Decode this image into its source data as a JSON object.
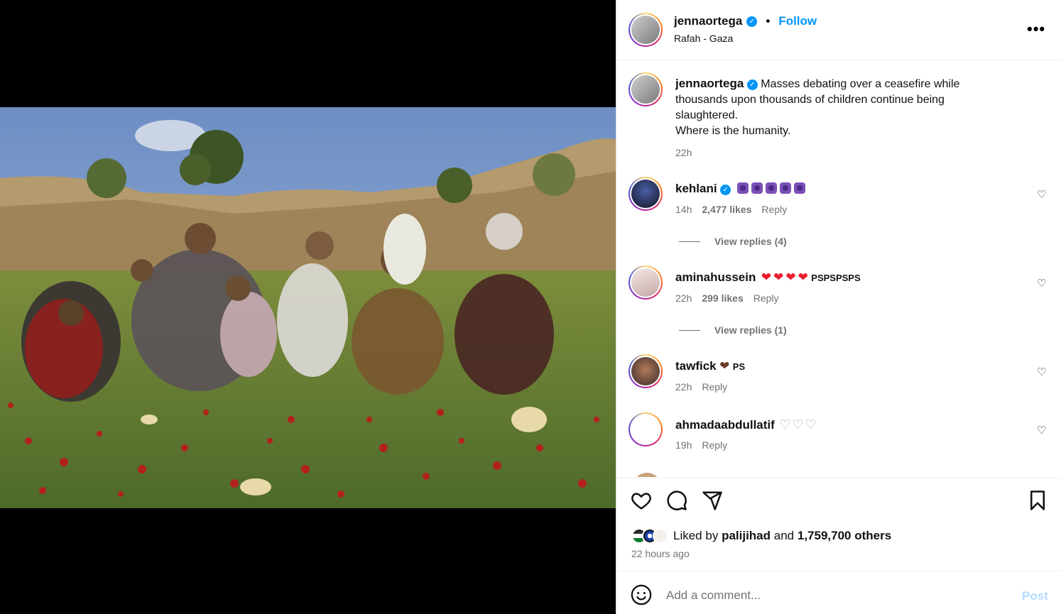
{
  "post": {
    "author": "jennaortega",
    "follow_label": "Follow",
    "dot": "•",
    "location": "Rafah - Gaza",
    "more": "•••",
    "verified_mark": "✓"
  },
  "caption": {
    "author": "jennaortega",
    "lines": [
      "Masses debating over a ceasefire while",
      "thousands upon thousands of children continue being",
      "slaughtered.",
      "Where is the humanity."
    ],
    "time": "22h"
  },
  "comments": [
    {
      "user": "kehlani",
      "verified": true,
      "text_extra": "",
      "time": "14h",
      "likes": "2,477 likes",
      "reply": "Reply",
      "view_replies": "View replies (4)"
    },
    {
      "user": "aminahussein",
      "verified": false,
      "text_extra": "PSPSPSPS",
      "time": "22h",
      "likes": "299 likes",
      "reply": "Reply",
      "view_replies": "View replies (1)"
    },
    {
      "user": "tawfick",
      "verified": false,
      "text_extra": "PS",
      "time": "22h",
      "likes": "",
      "reply": "Reply",
      "view_replies": ""
    },
    {
      "user": "ahmadaabdullatif",
      "verified": false,
      "text_extra": "",
      "time": "19h",
      "likes": "",
      "reply": "Reply",
      "view_replies": ""
    }
  ],
  "likes": {
    "prefix": "Liked by",
    "user": "palijihad",
    "and": "and",
    "count": "1,759,700 others"
  },
  "timestamp": "22 hours ago",
  "comment_box": {
    "placeholder": "Add a comment...",
    "post_label": "Post"
  },
  "icons": {
    "like": "heart-icon",
    "comment": "comment-icon",
    "share": "share-icon",
    "save": "bookmark-icon",
    "emoji": "emoji-icon",
    "more": "more-icon"
  },
  "colors": {
    "accent": "#0095f6",
    "muted": "#737373",
    "post_disabled": "#b3dbff"
  }
}
